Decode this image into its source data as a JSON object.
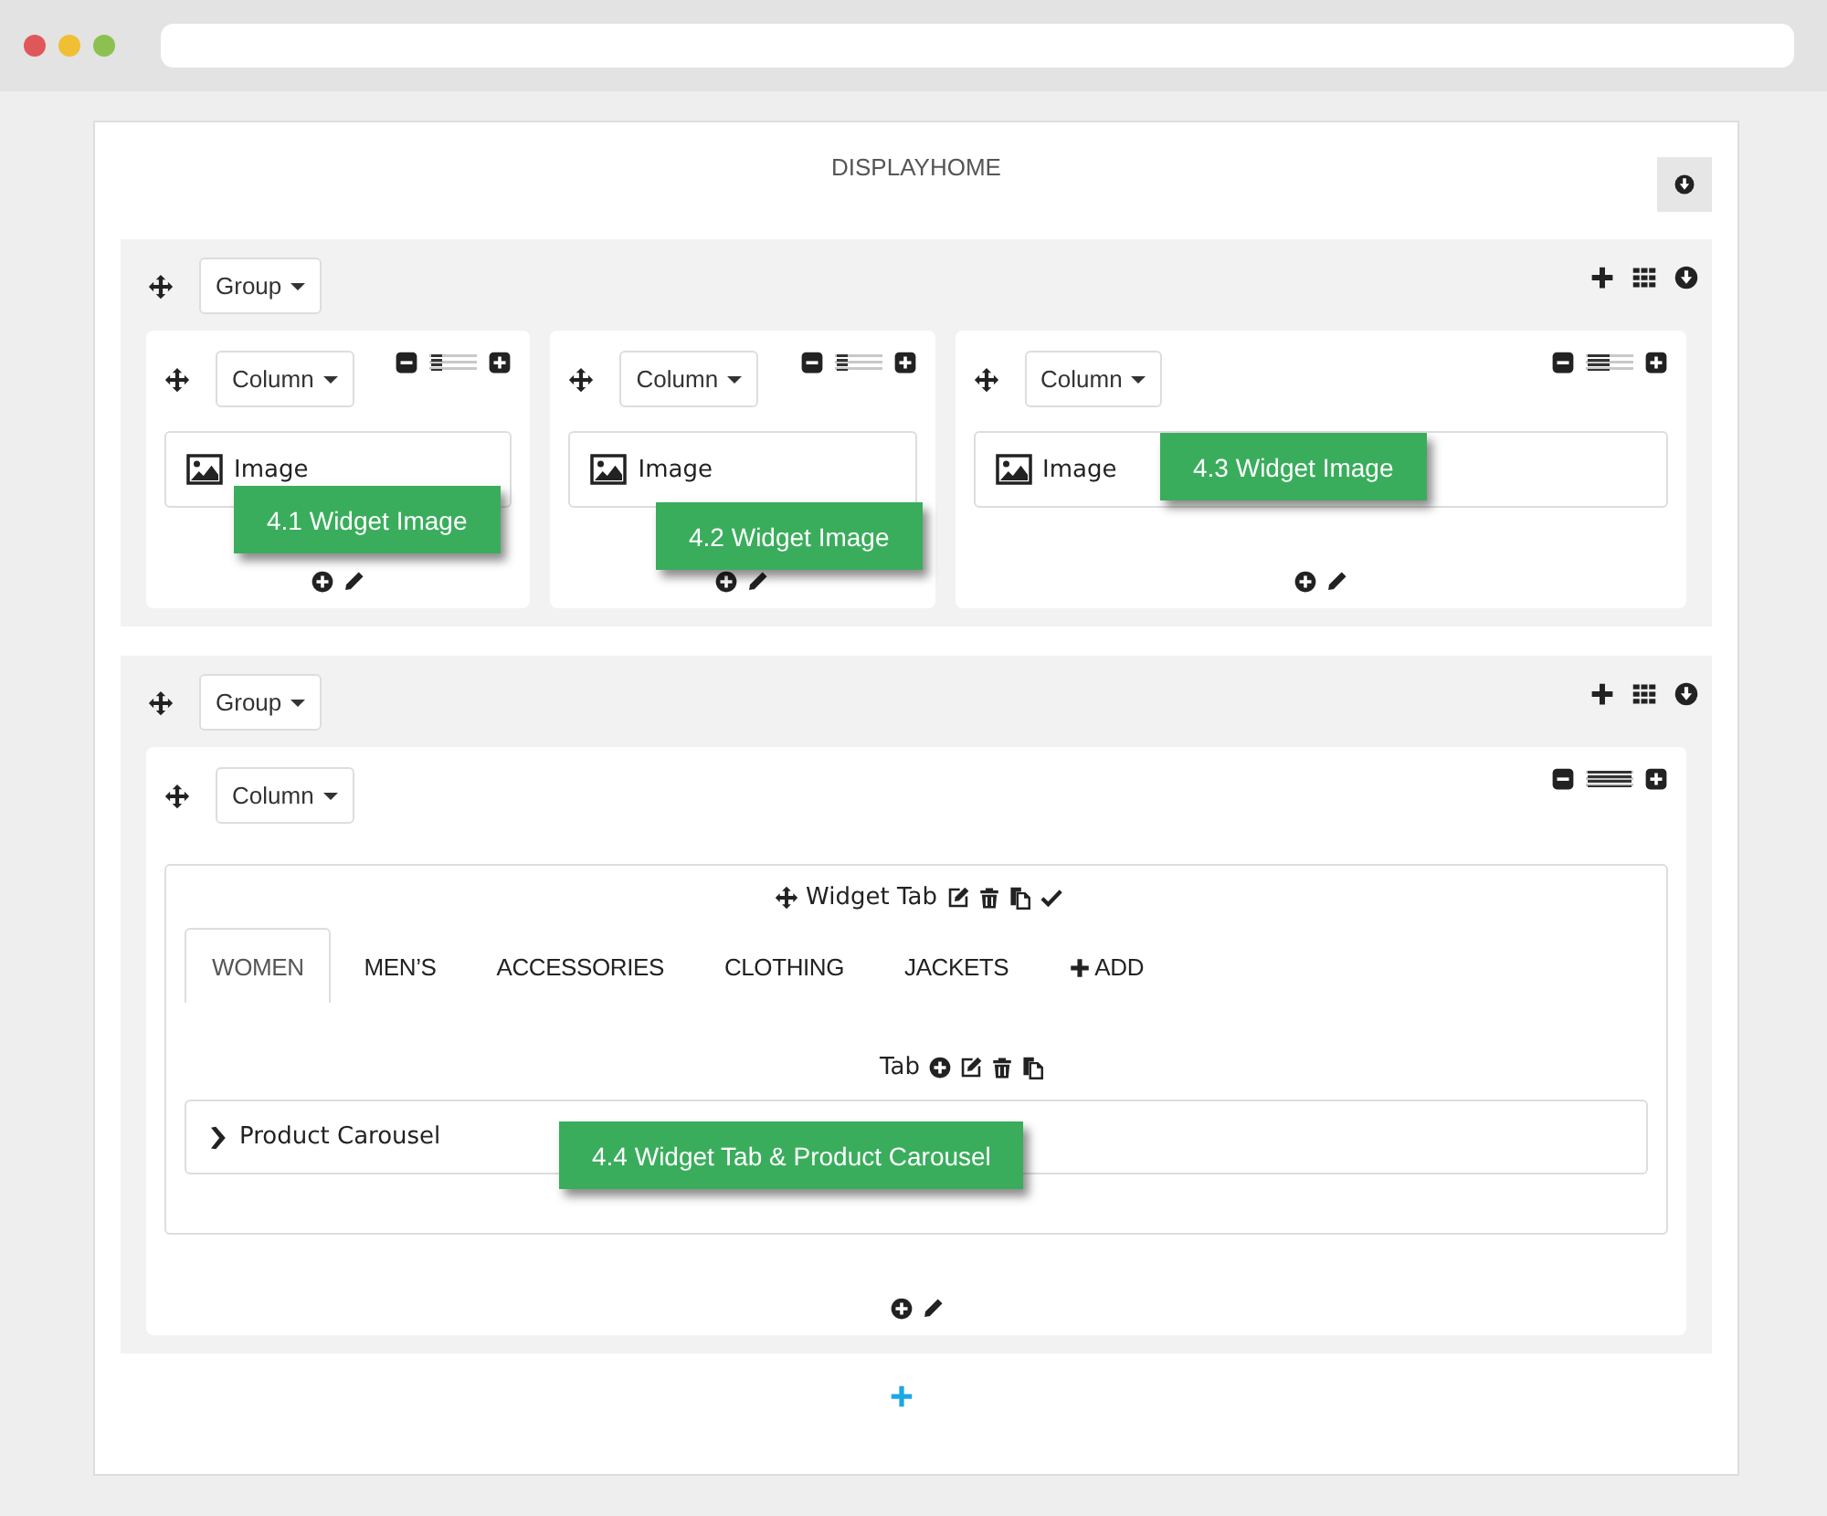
{
  "page_title": "DISPLAYHOME",
  "groups": [
    {
      "label": "Group",
      "columns": [
        {
          "label": "Column",
          "level": 0.25,
          "widgets": [
            {
              "kind": "image",
              "label": "Image"
            }
          ]
        },
        {
          "label": "Column",
          "level": 0.25,
          "widgets": [
            {
              "kind": "image",
              "label": "Image"
            }
          ]
        },
        {
          "label": "Column",
          "level": 0.5,
          "widgets": [
            {
              "kind": "image",
              "label": "Image"
            }
          ]
        }
      ]
    },
    {
      "label": "Group",
      "columns": [
        {
          "label": "Column",
          "level": 1,
          "widgets": [
            {
              "kind": "tabs",
              "title": "Widget Tab",
              "tabs": [
                {
                  "label": "WOMEN",
                  "selected": true
                },
                {
                  "label": "MEN’S",
                  "selected": false
                },
                {
                  "label": "ACCESSORIES",
                  "selected": false
                },
                {
                  "label": "CLOTHING",
                  "selected": false
                },
                {
                  "label": "JACKETS",
                  "selected": false
                }
              ],
              "add_label": "ADD",
              "tab_label": "Tab",
              "items": [
                {
                  "label": "Product Carousel"
                }
              ]
            }
          ]
        }
      ]
    }
  ],
  "callouts": [
    {
      "text": "4.1 Widget Image"
    },
    {
      "text": "4.2 Widget Image"
    },
    {
      "text": "4.3 Widget Image"
    },
    {
      "text": "4.4 Widget Tab & Product Carousel"
    }
  ]
}
